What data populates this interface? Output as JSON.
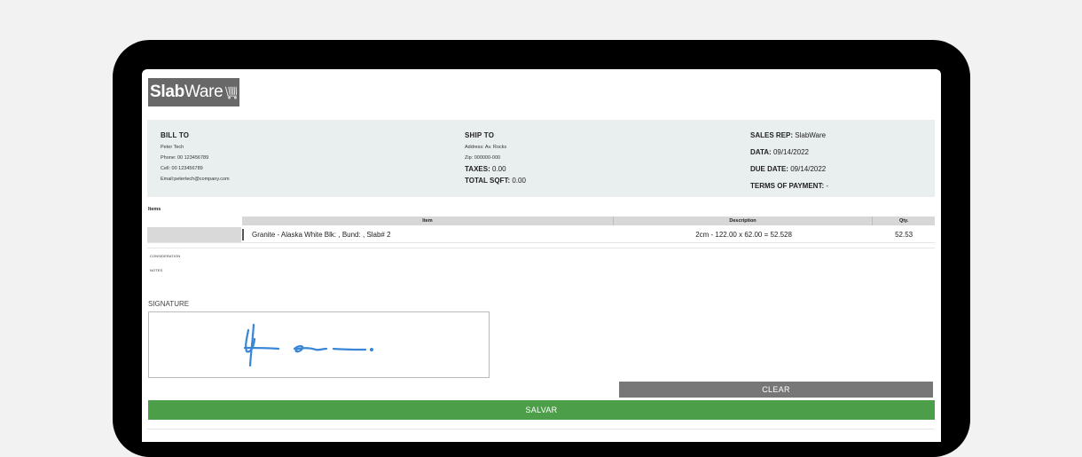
{
  "logo": {
    "bold": "Slab",
    "light": "Ware",
    "icon": "cart-icon"
  },
  "bill_to": {
    "title": "BILL TO",
    "name": "Peter Tech",
    "phone": "Phone: 00 123456789",
    "cell": "Cell: 00 123456789",
    "email": "Email:petertech@company.com"
  },
  "ship_to": {
    "title": "SHIP TO",
    "address": "Address: Av. Rocks",
    "zip": "Zip: 000000-000",
    "taxes_label": "TAXES:",
    "taxes_value": "0.00",
    "sqft_label": "TOTAL SQFT:",
    "sqft_value": "0.00"
  },
  "sales": {
    "rep_label": "SALES REP:",
    "rep_value": "SlabWare",
    "data_label": "DATA:",
    "data_value": "09/14/2022",
    "due_label": "DUE DATE:",
    "due_value": "09/14/2022",
    "terms_label": "TERMS OF PAYMENT:",
    "terms_value": "-"
  },
  "items": {
    "title": "Items",
    "columns": [
      "Item",
      "Description",
      "Qty."
    ],
    "rows": [
      {
        "item": "Granite - Alaska White Blk: , Bund: , Slab# 2",
        "description": "2cm - 122.00 x 62.00 = 52.528",
        "qty": "52.53"
      }
    ]
  },
  "labels": {
    "consideration": "CONSIDERATION",
    "notes": "NOTES",
    "signature": "SIGNATURE"
  },
  "buttons": {
    "clear": "CLEAR",
    "save": "SALVAR"
  },
  "colors": {
    "save": "#4d9e48",
    "clear": "#777777",
    "info_bg": "#e9eeef",
    "signature_ink": "#3a86d6"
  }
}
